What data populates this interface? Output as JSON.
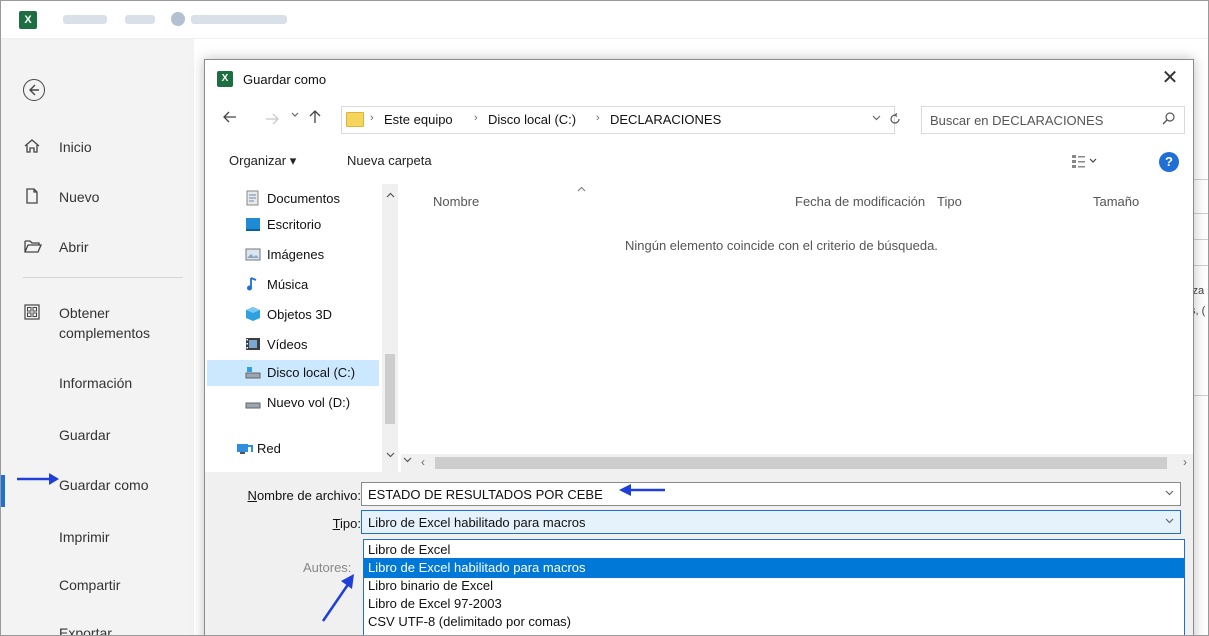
{
  "excel": {
    "logo": "X"
  },
  "backstage": {
    "items": [
      {
        "label": "Inicio",
        "icon": "home-icon"
      },
      {
        "label": "Nuevo",
        "icon": "new-file-icon"
      },
      {
        "label": "Abrir",
        "icon": "open-folder-icon"
      },
      {
        "label": "Obtener complementos",
        "icon": "addins-icon"
      },
      {
        "label": "Información"
      },
      {
        "label": "Guardar"
      },
      {
        "label": "Guardar como"
      },
      {
        "label": "Imprimir"
      },
      {
        "label": "Compartir"
      },
      {
        "label": "Exportar"
      }
    ],
    "selected": "Guardar como"
  },
  "right_bg_text": [
    "iza",
    "s, ("
  ],
  "dialog": {
    "title": "Guardar como",
    "close": "✕",
    "breadcrumb": [
      "Este equipo",
      "Disco local (C:)",
      "DECLARACIONES"
    ],
    "search_placeholder": "Buscar en DECLARACIONES",
    "toolbar": {
      "organize": "Organizar ▾",
      "new_folder": "Nueva carpeta"
    },
    "nav_pane": [
      {
        "label": "Documentos",
        "icon": "documents-icon"
      },
      {
        "label": "Escritorio",
        "icon": "desktop-icon"
      },
      {
        "label": "Imágenes",
        "icon": "pictures-icon"
      },
      {
        "label": "Música",
        "icon": "music-icon"
      },
      {
        "label": "Objetos 3D",
        "icon": "3d-objects-icon"
      },
      {
        "label": "Vídeos",
        "icon": "videos-icon"
      },
      {
        "label": "Disco local (C:)",
        "icon": "local-disk-icon",
        "selected": true
      },
      {
        "label": "Nuevo vol (D:)",
        "icon": "drive-icon"
      },
      {
        "label": "Red",
        "icon": "network-icon"
      }
    ],
    "columns": [
      "Nombre",
      "Fecha de modificación",
      "Tipo",
      "Tamaño"
    ],
    "empty_message": "Ningún elemento coincide con el criterio de búsqueda.",
    "filename_label": "Nombre de archivo:",
    "filename_label_accel": "N",
    "filename_label_rest": "ombre de archivo:",
    "filename_value": "ESTADO DE RESULTADOS POR CEBE",
    "type_label_accel": "T",
    "type_label_rest": "ipo:",
    "type_value": "Libro de Excel habilitado para macros",
    "authors_label": "Autores:",
    "type_options": [
      "Libro de Excel",
      "Libro de Excel habilitado para macros",
      "Libro binario de Excel",
      "Libro de Excel 97-2003",
      "CSV UTF-8 (delimitado por comas)"
    ],
    "highlighted_option": "Libro de Excel habilitado para macros"
  },
  "colors": {
    "accent": "#1f6fd6",
    "highlight": "#0078d7",
    "excel_green": "#1d6f42"
  }
}
